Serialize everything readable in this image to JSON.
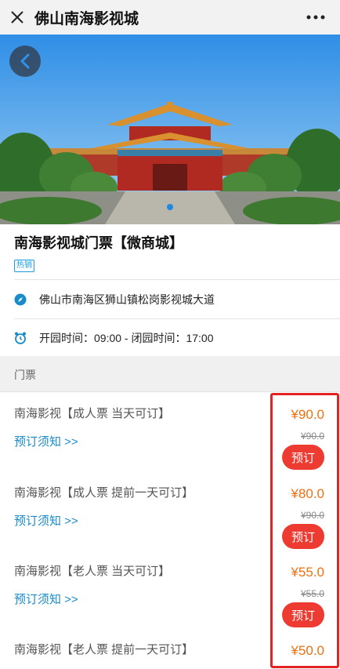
{
  "topbar": {
    "title": "佛山南海影视城"
  },
  "product": {
    "name": "南海影视城门票【微商城】",
    "badge": "热销",
    "address": "佛山市南海区狮山镇松岗影视城大道",
    "hours": "开园时间：09:00 - 闭园时间：17:00"
  },
  "section": {
    "title": "门票"
  },
  "tickets": [
    {
      "name": "南海影视【成人票 当天可订】",
      "notice": "预订须知 >>",
      "price": "¥90.0",
      "original_price": "¥90.0",
      "book_label": "预订"
    },
    {
      "name": "南海影视【成人票 提前一天可订】",
      "notice": "预订须知 >>",
      "price": "¥80.0",
      "original_price": "¥90.0",
      "book_label": "预订"
    },
    {
      "name": "南海影视【老人票 当天可订】",
      "notice": "预订须知 >>",
      "price": "¥55.0",
      "original_price": "¥55.0",
      "book_label": "预订"
    },
    {
      "name": "南海影视【老人票 提前一天可订】",
      "price": "¥50.0"
    }
  ],
  "colors": {
    "accent_link": "#1a8bc9",
    "price": "#f07010",
    "book_button": "#ee3b32",
    "highlight": "#e52222",
    "slide_dot": "#1e88e5"
  }
}
